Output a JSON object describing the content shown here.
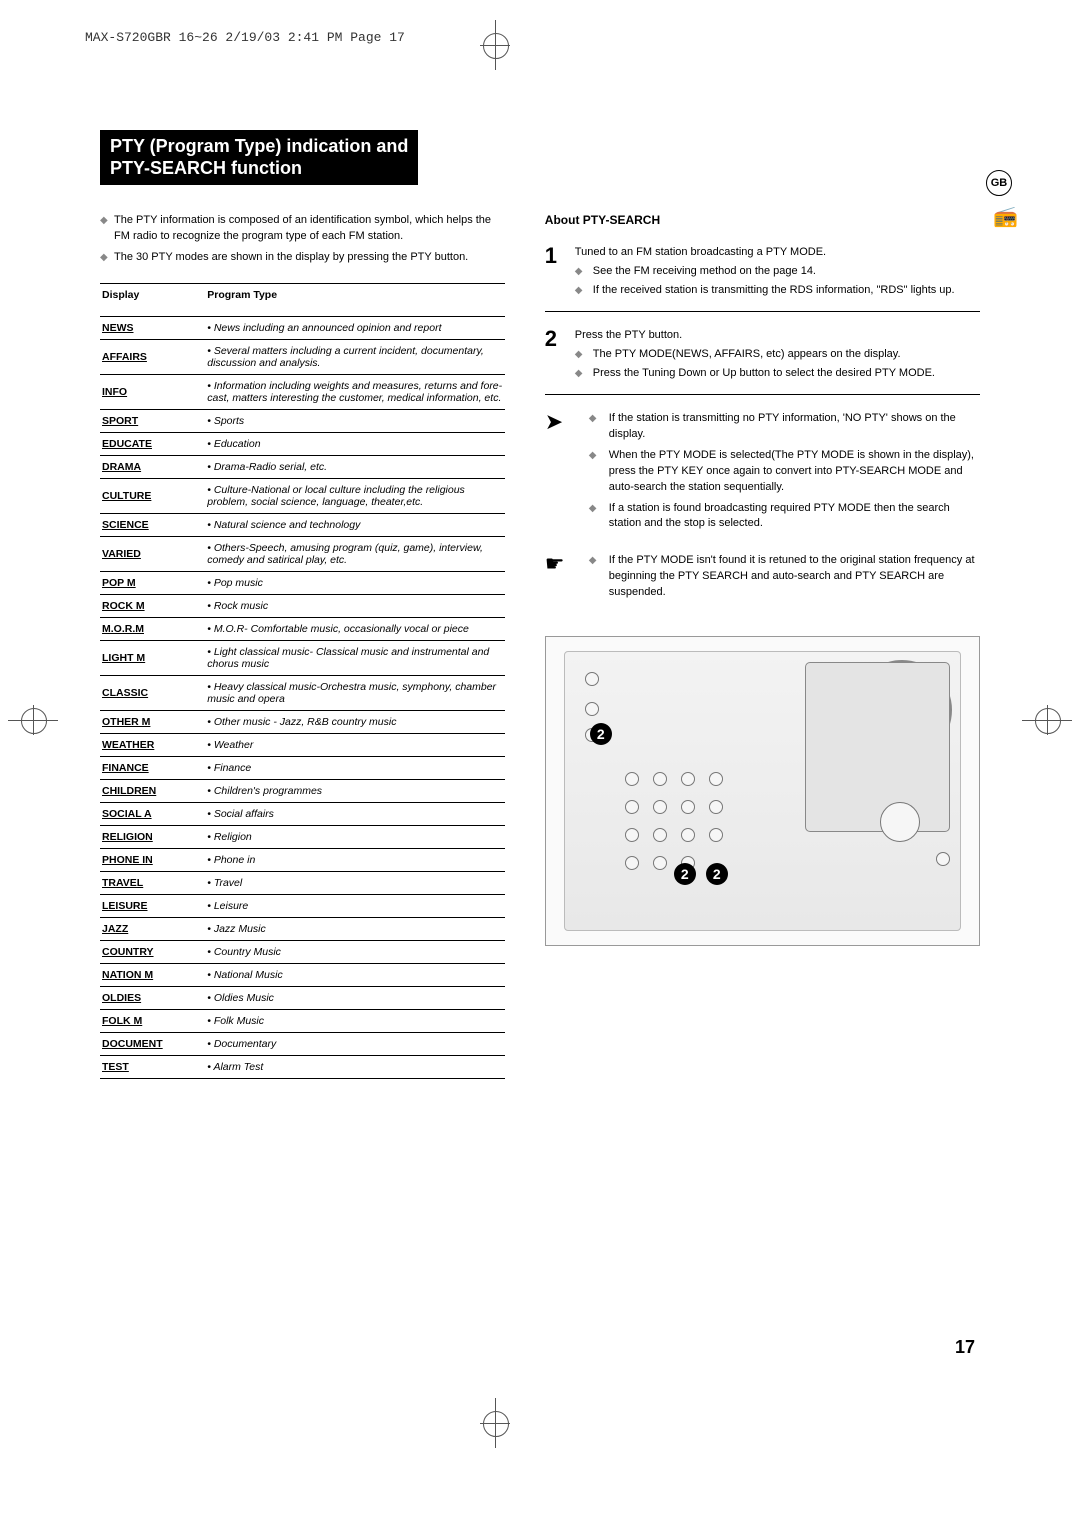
{
  "header_line": "MAX-S720GBR 16~26  2/19/03 2:41 PM  Page 17",
  "title_line1": "PTY (Program Type) indication and",
  "title_line2": "PTY-SEARCH function",
  "intro": [
    "The PTY information is composed of an identification symbol, which helps the FM radio to recognize the program type of each FM station.",
    "The 30 PTY modes are shown in the display by pressing the PTY button."
  ],
  "table": {
    "col1": "Display",
    "col2": "Program Type",
    "rows": [
      {
        "d": "NEWS",
        "p": "• News including an announced opinion and report"
      },
      {
        "d": "AFFAIRS",
        "p": "• Several matters including a current incident, documentary, discussion and analysis."
      },
      {
        "d": "INFO",
        "p": "• Information including weights and measures, returns and fore-cast, matters interesting the customer, medical information, etc."
      },
      {
        "d": "SPORT",
        "p": "• Sports"
      },
      {
        "d": "EDUCATE",
        "p": "• Education"
      },
      {
        "d": "DRAMA",
        "p": "• Drama-Radio serial, etc."
      },
      {
        "d": "CULTURE",
        "p": "• Culture-National or local culture including the religious problem, social science, language, theater,etc."
      },
      {
        "d": "SCIENCE",
        "p": "• Natural science and technology"
      },
      {
        "d": "VARIED",
        "p": "• Others-Speech, amusing program (quiz, game), interview, comedy and satirical play, etc."
      },
      {
        "d": "POP M",
        "p": "• Pop music"
      },
      {
        "d": "ROCK M",
        "p": "• Rock music"
      },
      {
        "d": "M.O.R.M",
        "p": "• M.O.R- Comfortable music, occasionally vocal or piece"
      },
      {
        "d": "LIGHT M",
        "p": "• Light classical music- Classical music and instrumental and chorus music"
      },
      {
        "d": "CLASSIC",
        "p": "• Heavy classical  music-Orchestra music, symphony, chamber music and opera"
      },
      {
        "d": "OTHER M",
        "p": "• Other music - Jazz, R&B country music"
      },
      {
        "d": "WEATHER",
        "p": "• Weather"
      },
      {
        "d": "FINANCE",
        "p": "• Finance"
      },
      {
        "d": "CHILDREN",
        "p": "• Children's programmes"
      },
      {
        "d": "SOCIAL  A",
        "p": "• Social affairs"
      },
      {
        "d": "RELIGION",
        "p": "• Religion"
      },
      {
        "d": "PHONE IN",
        "p": "• Phone in"
      },
      {
        "d": "TRAVEL",
        "p": "• Travel"
      },
      {
        "d": "LEISURE",
        "p": "• Leisure"
      },
      {
        "d": "JAZZ",
        "p": "• Jazz Music"
      },
      {
        "d": "COUNTRY",
        "p": "• Country Music"
      },
      {
        "d": "NATION M",
        "p": "• National Music"
      },
      {
        "d": "OLDIES",
        "p": "• Oldies Music"
      },
      {
        "d": "FOLK M",
        "p": "• Folk Music"
      },
      {
        "d": "DOCUMENT",
        "p": "• Documentary"
      },
      {
        "d": "TEST",
        "p": "• Alarm Test"
      }
    ]
  },
  "right": {
    "about": "About PTY-SEARCH",
    "step1": {
      "num": "1",
      "main": "Tuned to an FM station broadcasting a PTY MODE.",
      "subs": [
        "See the FM receiving method on the page 14.",
        "If the received station is transmitting the RDS information, \"RDS\" lights up."
      ]
    },
    "step2": {
      "num": "2",
      "main": "Press the PTY button.",
      "subs": [
        "The PTY MODE(NEWS, AFFAIRS, etc) appears on the display.",
        "Press the Tuning Down or Up button to select the desired PTY MODE."
      ]
    },
    "note1": [
      "If the station is transmitting no PTY information, 'NO PTY' shows on the display.",
      "When the PTY MODE is selected(The PTY MODE is shown in  the display), press the PTY KEY once again to convert into PTY-SEARCH MODE and auto-search the station sequentially.",
      "If a station is found broadcasting required PTY MODE then the search station and the stop is selected."
    ],
    "note2": [
      "If the PTY MODE isn't found it is retuned to the original station frequency at beginning the PTY SEARCH and auto-search and PTY SEARCH are suspended."
    ],
    "callout": "2"
  },
  "side_badge": "GB",
  "page_num": "17"
}
